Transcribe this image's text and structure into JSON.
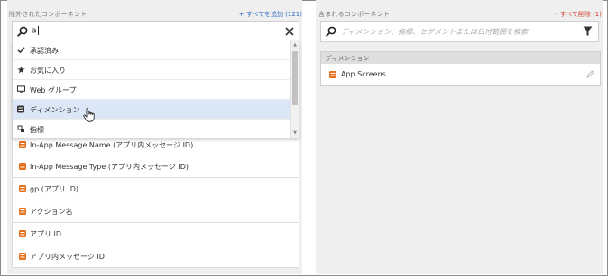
{
  "left_panel": {
    "title": "除外されたコンポーネント",
    "action": "+ すべてを追加 (121)",
    "search": {
      "value": "a"
    },
    "dropdown_items": [
      {
        "label": "承認済み",
        "icon": "checkmark-icon"
      },
      {
        "label": "お気に入り",
        "icon": "star-icon"
      },
      {
        "label": "Web グループ",
        "icon": "monitor-icon"
      },
      {
        "label": "ディメンション",
        "icon": "dimension-icon",
        "active": true
      },
      {
        "label": "指標",
        "icon": "metric-icon"
      }
    ],
    "components": [
      "In-App Message Name (アプリ内メッセージ ID)",
      "In-App Message Type (アプリ内メッセージ ID)",
      "gp (アプリ ID)",
      "アクション名",
      "アプリ ID",
      "アプリ内メッセージ ID"
    ]
  },
  "right_panel": {
    "title": "含まれるコンポーネント",
    "action": "- すべて削除 (1)",
    "search": {
      "placeholder": "ディメンション、指標、セグメントまたは日付範囲を検索"
    },
    "section_header": "ディメンション",
    "included": [
      "App Screens"
    ]
  },
  "colors": {
    "panel_bg": "#efefef",
    "add_link": "#2d6ec4",
    "remove_link": "#d13a2f",
    "dimension_icon": "#e8711f",
    "active_item_bg": "#dbe7f6"
  }
}
